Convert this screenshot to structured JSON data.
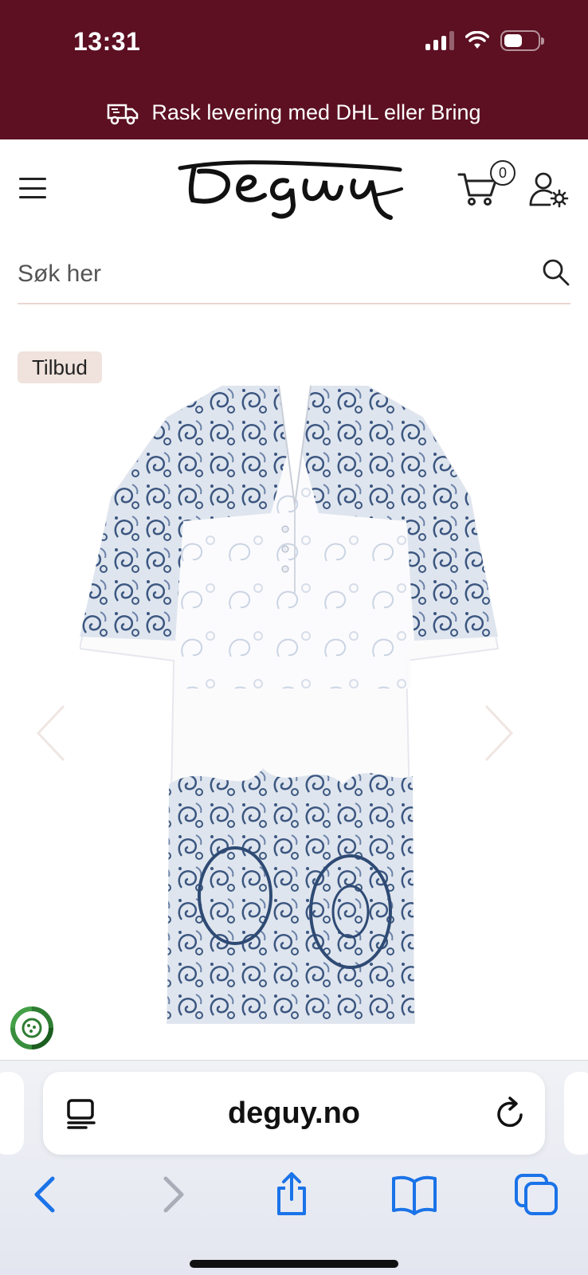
{
  "status_bar": {
    "time": "13:31"
  },
  "promo": {
    "text": "Rask levering med DHL eller Bring",
    "icon": "truck-icon"
  },
  "header": {
    "logo_text": "Deguy",
    "cart_count": "0",
    "icons": [
      "menu-icon",
      "cart-icon",
      "account-settings-icon"
    ]
  },
  "search": {
    "placeholder": "Søk her",
    "value": ""
  },
  "product": {
    "badge": "Tilbud",
    "image_alt": "Hvit kjole med blått paisleymønster"
  },
  "browser": {
    "url": "deguy.no"
  },
  "colors": {
    "brand": "#5c1022",
    "badge_bg": "#f0e2dc",
    "ios_blue": "#1a73e8",
    "pattern_blue": "#4a6591"
  }
}
